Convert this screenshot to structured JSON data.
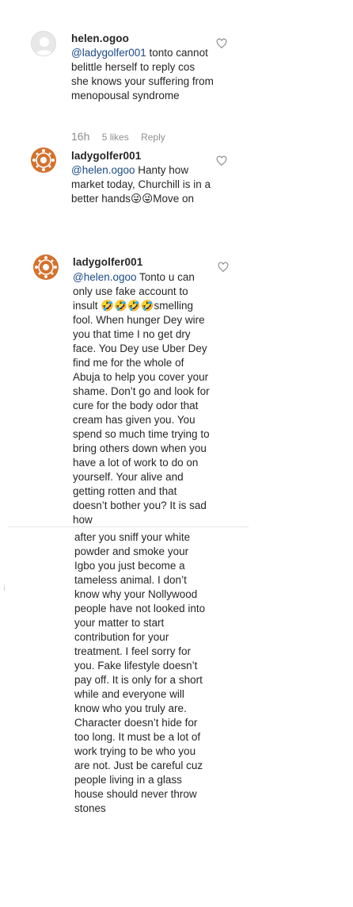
{
  "comments": [
    {
      "username": "helen.ogoo",
      "mention": "@ladygolfer001",
      "text": " tonto cannot belittle herself to reply cos she knows your suffering from menopousal syndrome",
      "time": "16h",
      "likes": "5 likes",
      "reply": "Reply"
    },
    {
      "username": "ladygolfer001",
      "mention": "@helen.ogoo",
      "text": " Hanty how market today, Churchill is in a better hands😜😜Move on"
    },
    {
      "username": "ladygolfer001",
      "mention": "@helen.ogoo",
      "text_part1": " Tonto u can only use fake account to insult 🤣🤣🤣🤣smelling fool. When hunger Dey wire you that time I no get dry face. You Dey use Uber Dey find me for the whole of Abuja to help you cover your shame. Don’t go and look for cure for the body odor that cream has given you. You spend so much time trying to bring others down when you have a lot of work to do on yourself. Your alive and getting rotten and that doesn’t bother you? It is sad how",
      "text_part2": "after you sniff your white powder and smoke your Igbo you just become a tameless animal. I don’t know why your Nollywood people have not looked into your matter to start contribution for your treatment. I feel sorry for you. Fake lifestyle doesn’t pay off. It is only for a short while and everyone will know who you truly are. Character doesn’t hide for too long. It must be a lot of work trying to be who you are not. Just be careful cuz people living in a glass house should never throw stones"
    }
  ],
  "icons": {
    "like": "heart-outline-icon",
    "avatar_default": "default-avatar-icon",
    "avatar_orange": "orange-pattern-avatar-icon"
  },
  "colors": {
    "mention": "#1a4a85",
    "meta": "#8e8e8e",
    "avatar_orange": "#d4722e"
  }
}
